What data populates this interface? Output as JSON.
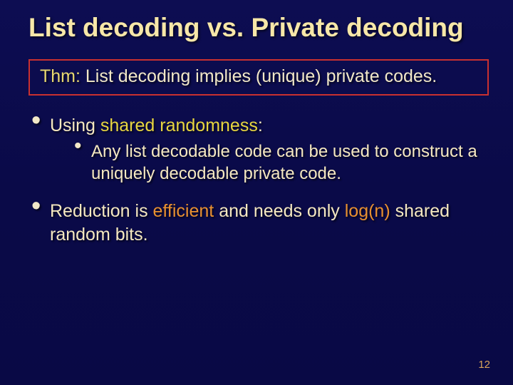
{
  "title": "List decoding vs. Private decoding",
  "theorem": {
    "label": "Thm:",
    "text": " List decoding implies (unique) private codes."
  },
  "bullets": {
    "b1": {
      "pre": "Using ",
      "hl": "shared randomness",
      "post": ":"
    },
    "b1a": "Any list decodable code can be used to construct a uniquely decodable private code.",
    "b2": {
      "pre": "Reduction is ",
      "eff": "efficient",
      "mid": " and needs only ",
      "log": "log(n)",
      "post": " shared random bits."
    }
  },
  "page_number": "12"
}
